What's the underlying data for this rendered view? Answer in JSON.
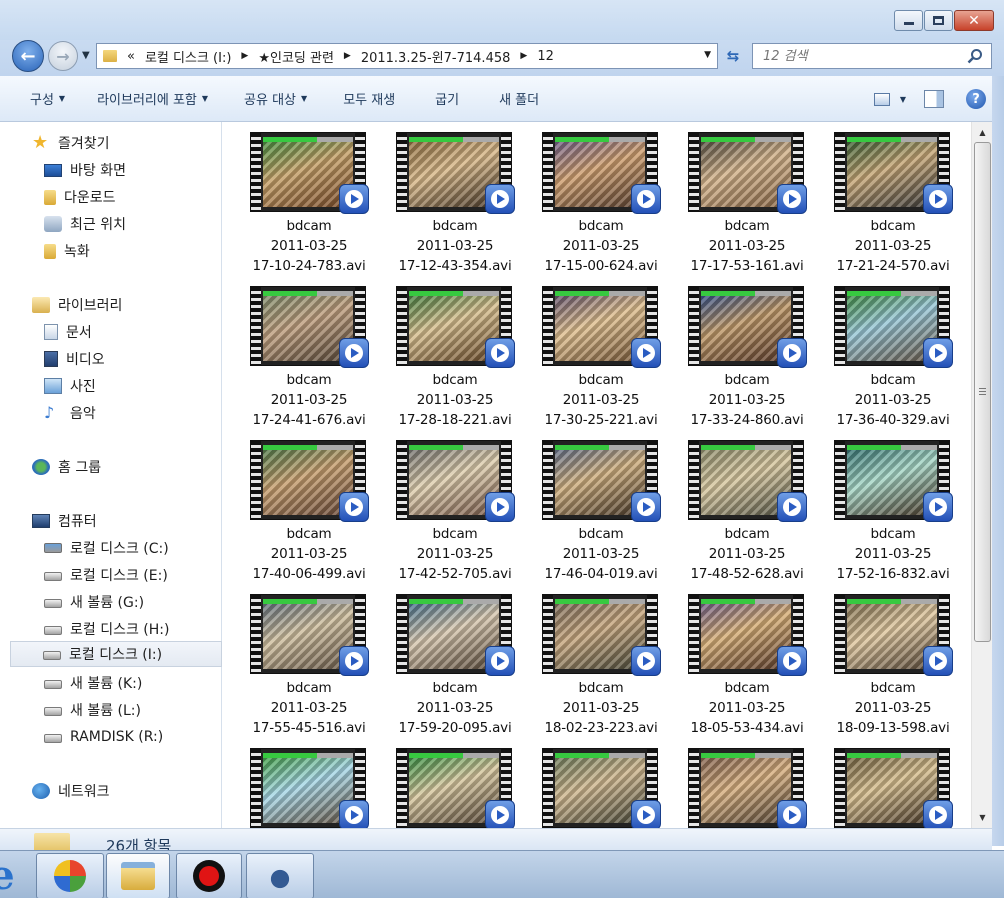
{
  "address": {
    "crumbs": [
      "«",
      "로컬 디스크 (I:)",
      "★인코딩 관련",
      "2011.3.25-윈7-714.458",
      "12"
    ]
  },
  "search": {
    "placeholder": "12 검색"
  },
  "toolbar": {
    "organize": "구성",
    "include_library": "라이브러리에 포함",
    "share": "공유 대상",
    "play_all": "모두 재생",
    "burn": "굽기",
    "new_folder": "새 폴더"
  },
  "nav": {
    "favorites": "즐겨찾기",
    "desktop": "바탕 화면",
    "downloads": "다운로드",
    "recent": "최근 위치",
    "recordings": "녹화",
    "libraries": "라이브러리",
    "documents": "문서",
    "videos": "비디오",
    "pictures": "사진",
    "music": "음악",
    "homegroup": "홈 그룹",
    "computer": "컴퓨터",
    "drives": [
      "로컬 디스크 (C:)",
      "로컬 디스크 (E:)",
      "새 볼륨 (G:)",
      "로컬 디스크 (H:)",
      "로컬 디스크 (I:)",
      "새 볼륨 (K:)",
      "새 볼륨 (L:)",
      "RAMDISK (R:)"
    ],
    "network": "네트워크"
  },
  "files": [
    {
      "line1": "bdcam",
      "line2": "2011-03-25",
      "line3": "17-10-24-783.avi"
    },
    {
      "line1": "bdcam",
      "line2": "2011-03-25",
      "line3": "17-12-43-354.avi"
    },
    {
      "line1": "bdcam",
      "line2": "2011-03-25",
      "line3": "17-15-00-624.avi"
    },
    {
      "line1": "bdcam",
      "line2": "2011-03-25",
      "line3": "17-17-53-161.avi"
    },
    {
      "line1": "bdcam",
      "line2": "2011-03-25",
      "line3": "17-21-24-570.avi"
    },
    {
      "line1": "bdcam",
      "line2": "2011-03-25",
      "line3": "17-24-41-676.avi"
    },
    {
      "line1": "bdcam",
      "line2": "2011-03-25",
      "line3": "17-28-18-221.avi"
    },
    {
      "line1": "bdcam",
      "line2": "2011-03-25",
      "line3": "17-30-25-221.avi"
    },
    {
      "line1": "bdcam",
      "line2": "2011-03-25",
      "line3": "17-33-24-860.avi"
    },
    {
      "line1": "bdcam",
      "line2": "2011-03-25",
      "line3": "17-36-40-329.avi"
    },
    {
      "line1": "bdcam",
      "line2": "2011-03-25",
      "line3": "17-40-06-499.avi"
    },
    {
      "line1": "bdcam",
      "line2": "2011-03-25",
      "line3": "17-42-52-705.avi"
    },
    {
      "line1": "bdcam",
      "line2": "2011-03-25",
      "line3": "17-46-04-019.avi"
    },
    {
      "line1": "bdcam",
      "line2": "2011-03-25",
      "line3": "17-48-52-628.avi"
    },
    {
      "line1": "bdcam",
      "line2": "2011-03-25",
      "line3": "17-52-16-832.avi"
    },
    {
      "line1": "bdcam",
      "line2": "2011-03-25",
      "line3": "17-55-45-516.avi"
    },
    {
      "line1": "bdcam",
      "line2": "2011-03-25",
      "line3": "17-59-20-095.avi"
    },
    {
      "line1": "bdcam",
      "line2": "2011-03-25",
      "line3": "18-02-23-223.avi"
    },
    {
      "line1": "bdcam",
      "line2": "2011-03-25",
      "line3": "18-05-53-434.avi"
    },
    {
      "line1": "bdcam",
      "line2": "2011-03-25",
      "line3": "18-09-13-598.avi"
    },
    {
      "line1": "",
      "line2": "",
      "line3": ""
    },
    {
      "line1": "",
      "line2": "",
      "line3": ""
    },
    {
      "line1": "",
      "line2": "",
      "line3": ""
    },
    {
      "line1": "",
      "line2": "",
      "line3": ""
    },
    {
      "line1": "",
      "line2": "",
      "line3": ""
    }
  ],
  "details": {
    "count": "26개 항목"
  },
  "icons": {
    "play_badge": "play-icon",
    "help": "help-icon",
    "search": "search-icon"
  }
}
